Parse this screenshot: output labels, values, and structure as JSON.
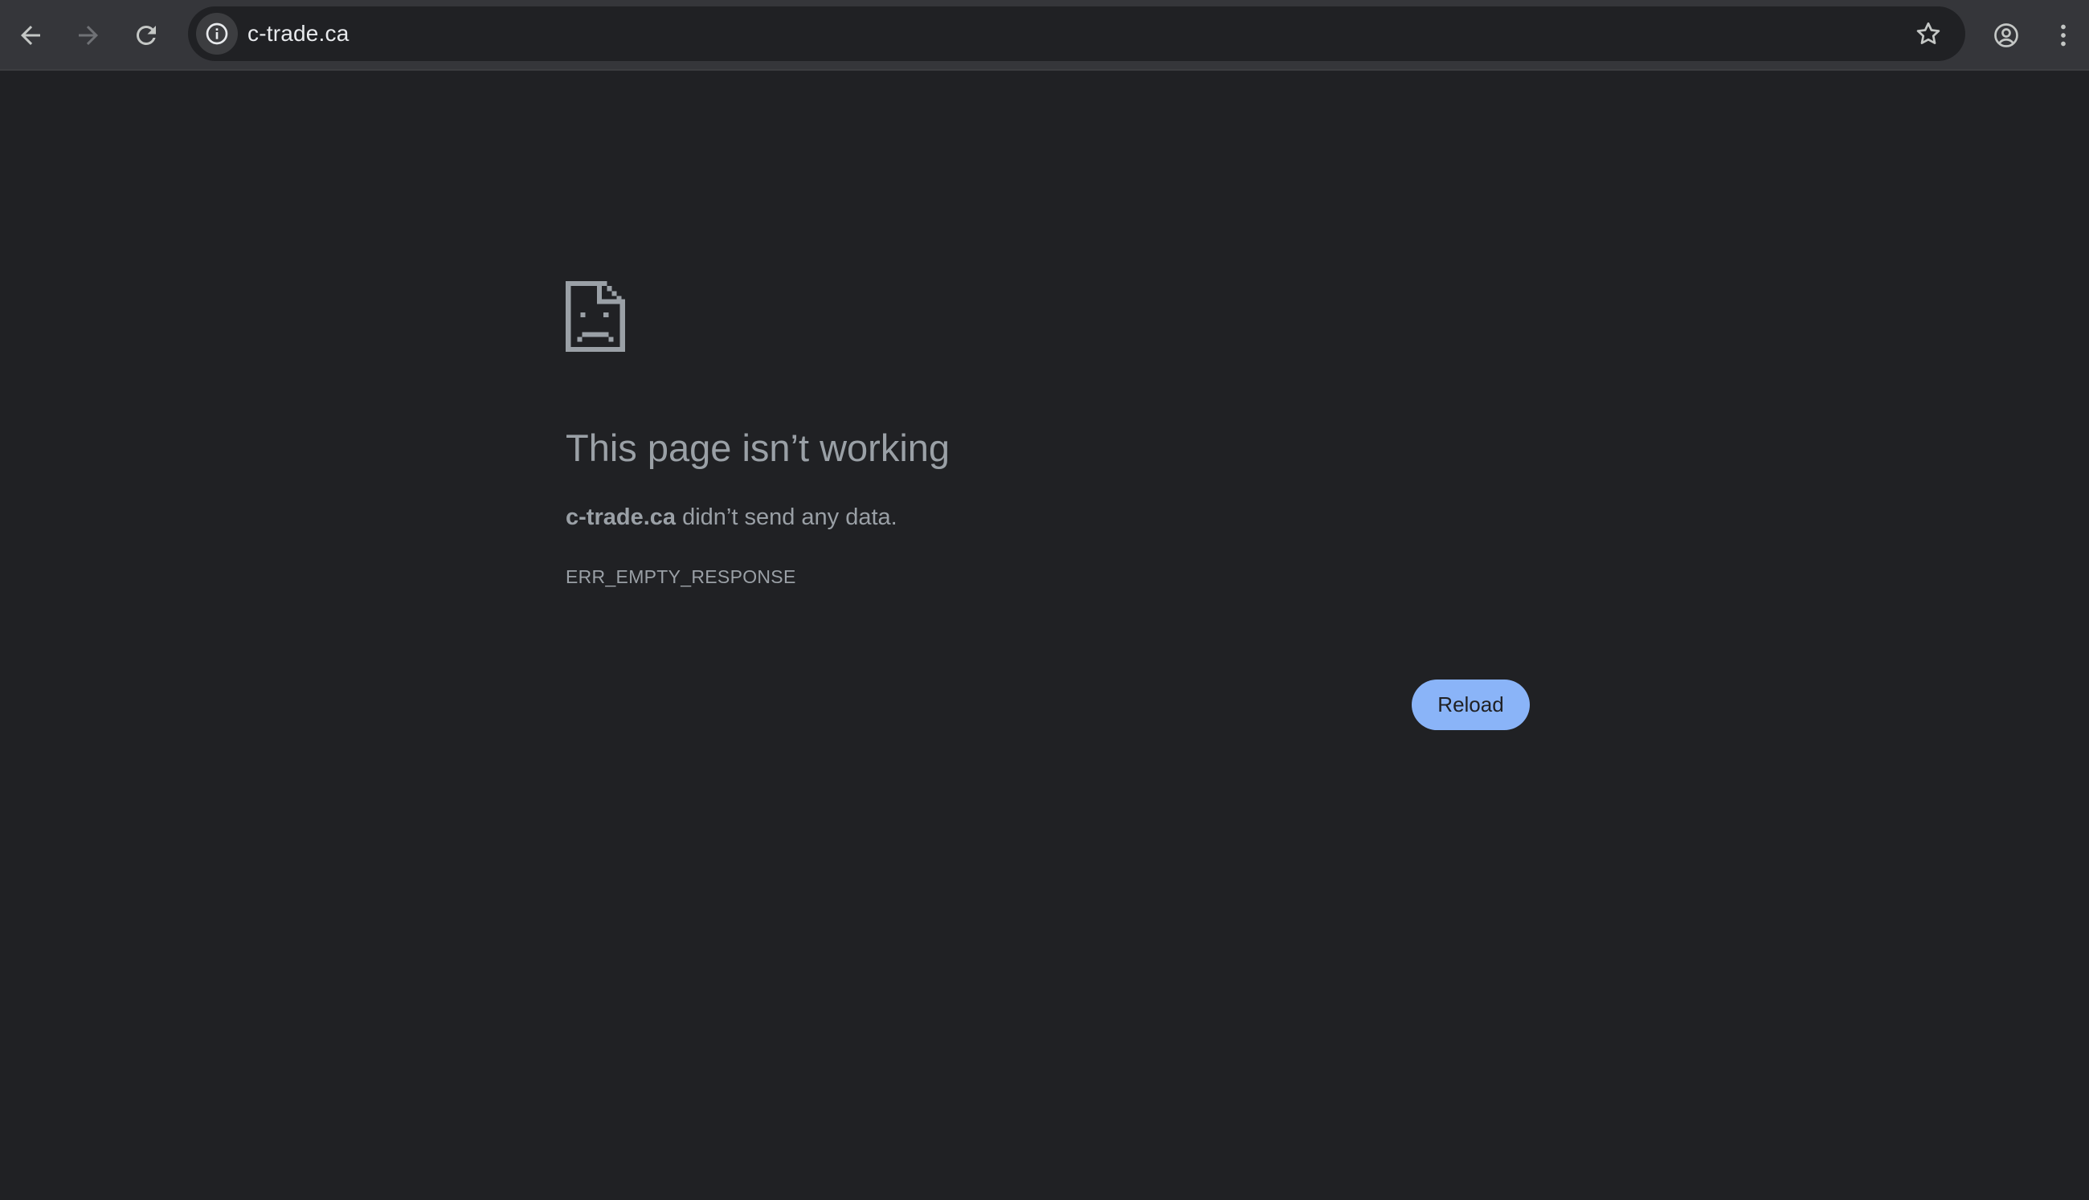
{
  "browser": {
    "url": "c-trade.ca",
    "icons": {
      "back": "arrow-left-icon",
      "forward": "arrow-right-icon",
      "reload": "reload-icon",
      "site_info": "info-icon",
      "bookmark": "star-icon",
      "profile": "account-circle-icon",
      "menu": "more-vertical-icon"
    }
  },
  "error_page": {
    "icon": "sad-page-icon",
    "title": "This page isn’t working",
    "description_host": "c-trade.ca",
    "description_rest": " didn’t send any data.",
    "error_code": "ERR_EMPTY_RESPONSE",
    "reload_label": "Reload"
  },
  "colors": {
    "page_background": "#202124",
    "toolbar_background": "#35363a",
    "accent_button": "#8ab4f8",
    "text_secondary": "#9aa0a6"
  }
}
